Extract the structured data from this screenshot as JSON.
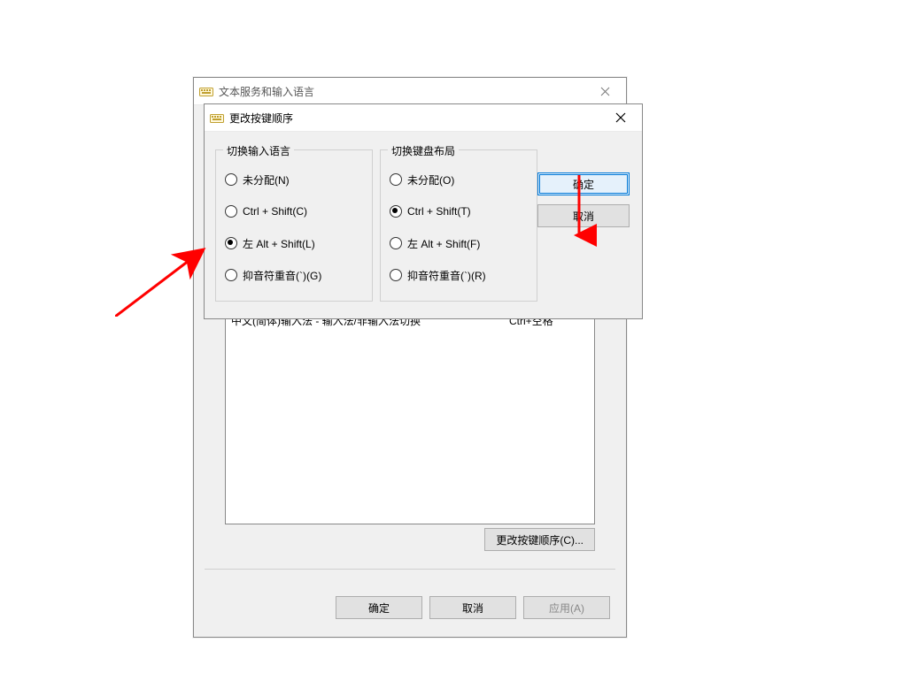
{
  "parent_dialog": {
    "title": "文本服务和输入语言",
    "list": {
      "row_label": "中文(简体)输入法 - 输入法/非输入法切换",
      "row_hotkey": "Ctrl+空格"
    },
    "change_seq_button": "更改按键顺序(C)...",
    "ok": "确定",
    "cancel": "取消",
    "apply": "应用(A)"
  },
  "child_dialog": {
    "title": "更改按键顺序",
    "group_left": {
      "legend": "切换输入语言",
      "options": {
        "opt_n": "未分配(N)",
        "opt_c": "Ctrl + Shift(C)",
        "opt_l": "左 Alt + Shift(L)",
        "opt_g": "抑音符重音(`)(G)"
      },
      "selected": "opt_l"
    },
    "group_right": {
      "legend": "切换键盘布局",
      "options": {
        "opt_o": "未分配(O)",
        "opt_t": "Ctrl + Shift(T)",
        "opt_f": "左 Alt + Shift(F)",
        "opt_r": "抑音符重音(`)(R)"
      },
      "selected": "opt_t"
    },
    "ok": "确定",
    "cancel": "取消"
  }
}
